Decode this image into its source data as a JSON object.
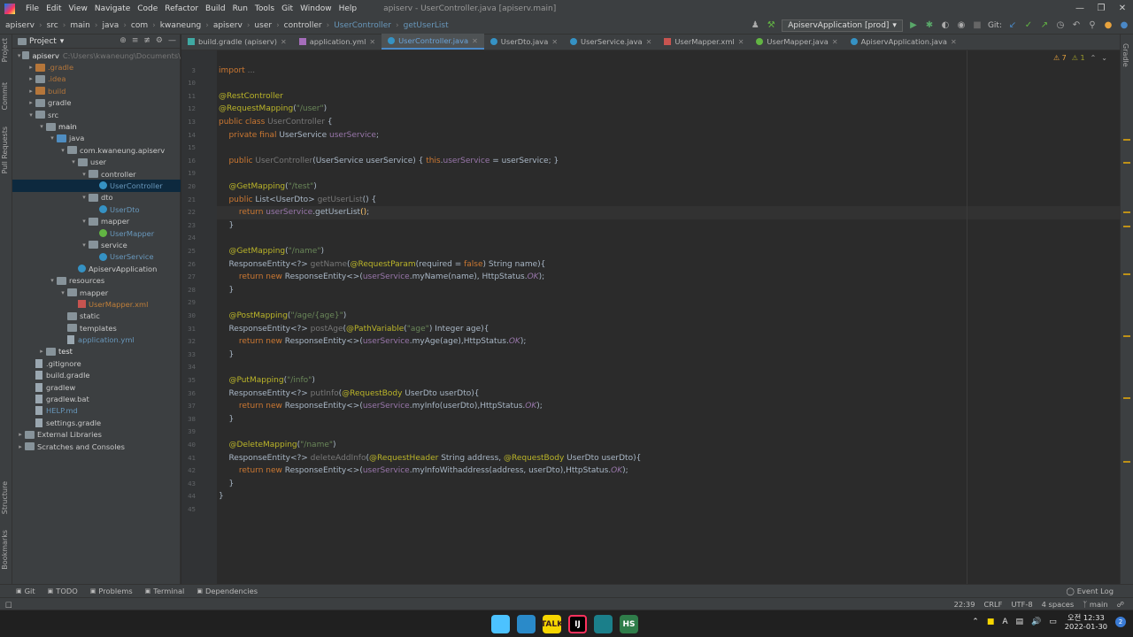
{
  "menubar": {
    "items": [
      "File",
      "Edit",
      "View",
      "Navigate",
      "Code",
      "Refactor",
      "Build",
      "Run",
      "Tools",
      "Git",
      "Window",
      "Help"
    ],
    "window_title": "apiserv - UserController.java [apiserv.main]",
    "controls": [
      "—",
      "❐",
      "✕"
    ]
  },
  "navbar": {
    "breadcrumbs": [
      "apiserv",
      "src",
      "main",
      "java",
      "com",
      "kwaneung",
      "apiserv",
      "user",
      "controller",
      "UserController",
      "getUserList"
    ],
    "run_config": "ApiservApplication [prod]",
    "git_label": "Git:"
  },
  "left_strip": [
    "Project",
    "Commit",
    "Pull Requests",
    "Structure",
    "Bookmarks"
  ],
  "project_panel": {
    "title": "Project",
    "tree": [
      {
        "label": "apiserv",
        "extra": "C:\\Users\\kwaneung\\Documents\\",
        "level": 0,
        "arrow": "▾",
        "icon": "folder",
        "style": "txt-bright"
      },
      {
        "label": ".gradle",
        "level": 1,
        "arrow": "▸",
        "icon": "folder orange",
        "style": "txt-orange"
      },
      {
        "label": ".idea",
        "level": 1,
        "arrow": "▸",
        "icon": "folder",
        "style": "txt-orange"
      },
      {
        "label": "build",
        "level": 1,
        "arrow": "▸",
        "icon": "folder orange",
        "style": "txt-orange"
      },
      {
        "label": "gradle",
        "level": 1,
        "arrow": "▸",
        "icon": "folder",
        "style": ""
      },
      {
        "label": "src",
        "level": 1,
        "arrow": "▾",
        "icon": "folder",
        "style": ""
      },
      {
        "label": "main",
        "level": 2,
        "arrow": "▾",
        "icon": "folder",
        "style": "txt-bright"
      },
      {
        "label": "java",
        "level": 3,
        "arrow": "▾",
        "icon": "folder blue",
        "style": ""
      },
      {
        "label": "com.kwaneung.apiserv",
        "level": 4,
        "arrow": "▾",
        "icon": "folder",
        "style": ""
      },
      {
        "label": "user",
        "level": 5,
        "arrow": "▾",
        "icon": "folder",
        "style": ""
      },
      {
        "label": "controller",
        "level": 6,
        "arrow": "▾",
        "icon": "folder",
        "style": ""
      },
      {
        "label": "UserController",
        "level": 7,
        "arrow": "",
        "icon": "cls",
        "style": "txt-blue",
        "selected": true
      },
      {
        "label": "dto",
        "level": 6,
        "arrow": "▾",
        "icon": "folder",
        "style": ""
      },
      {
        "label": "UserDto",
        "level": 7,
        "arrow": "",
        "icon": "cls",
        "style": "txt-blue"
      },
      {
        "label": "mapper",
        "level": 6,
        "arrow": "▾",
        "icon": "folder",
        "style": ""
      },
      {
        "label": "UserMapper",
        "level": 7,
        "arrow": "",
        "icon": "intf",
        "style": "txt-blue"
      },
      {
        "label": "service",
        "level": 6,
        "arrow": "▾",
        "icon": "folder",
        "style": ""
      },
      {
        "label": "UserService",
        "level": 7,
        "arrow": "",
        "icon": "cls",
        "style": "txt-blue"
      },
      {
        "label": "ApiservApplication",
        "level": 5,
        "arrow": "",
        "icon": "cls",
        "style": ""
      },
      {
        "label": "resources",
        "level": 3,
        "arrow": "▾",
        "icon": "folder",
        "style": ""
      },
      {
        "label": "mapper",
        "level": 4,
        "arrow": "▾",
        "icon": "folder",
        "style": ""
      },
      {
        "label": "UserMapper.xml",
        "level": 5,
        "arrow": "",
        "icon": "xml",
        "style": "txt-xml"
      },
      {
        "label": "static",
        "level": 4,
        "arrow": "",
        "icon": "folder",
        "style": ""
      },
      {
        "label": "templates",
        "level": 4,
        "arrow": "",
        "icon": "folder",
        "style": ""
      },
      {
        "label": "application.yml",
        "level": 4,
        "arrow": "",
        "icon": "file",
        "style": "txt-blue"
      },
      {
        "label": "test",
        "level": 2,
        "arrow": "▸",
        "icon": "folder",
        "style": "txt-bright"
      },
      {
        "label": ".gitignore",
        "level": 1,
        "arrow": "",
        "icon": "file",
        "style": ""
      },
      {
        "label": "build.gradle",
        "level": 1,
        "arrow": "",
        "icon": "file",
        "style": ""
      },
      {
        "label": "gradlew",
        "level": 1,
        "arrow": "",
        "icon": "file",
        "style": ""
      },
      {
        "label": "gradlew.bat",
        "level": 1,
        "arrow": "",
        "icon": "file",
        "style": ""
      },
      {
        "label": "HELP.md",
        "level": 1,
        "arrow": "",
        "icon": "file",
        "style": "txt-blue"
      },
      {
        "label": "settings.gradle",
        "level": 1,
        "arrow": "",
        "icon": "file",
        "style": ""
      },
      {
        "label": "External Libraries",
        "level": 0,
        "arrow": "▸",
        "icon": "folder",
        "style": ""
      },
      {
        "label": "Scratches and Consoles",
        "level": 0,
        "arrow": "▸",
        "icon": "folder",
        "style": ""
      }
    ]
  },
  "tabs": [
    {
      "label": "build.gradle (apiserv)",
      "icon": "gradle"
    },
    {
      "label": "application.yml",
      "icon": "yml"
    },
    {
      "label": "UserController.java",
      "icon": "cdot",
      "active": true
    },
    {
      "label": "UserDto.java",
      "icon": "cdot"
    },
    {
      "label": "UserService.java",
      "icon": "cdot"
    },
    {
      "label": "UserMapper.xml",
      "icon": "rdot"
    },
    {
      "label": "UserMapper.java",
      "icon": "gdot"
    },
    {
      "label": "ApiservApplication.java",
      "icon": "cdot"
    }
  ],
  "inspections": {
    "warnings": "⚠ 7",
    "weak": "⚠ 1"
  },
  "editor": {
    "current_line": 22,
    "lines": [
      {
        "n": "3",
        "t": [
          [
            "kw",
            "import "
          ],
          [
            "gr",
            "..."
          ]
        ]
      },
      {
        "n": "10",
        "t": []
      },
      {
        "n": "11",
        "t": [
          [
            "an",
            "@RestController"
          ]
        ]
      },
      {
        "n": "12",
        "t": [
          [
            "an",
            "@RequestMapping"
          ],
          [
            "pl",
            "("
          ],
          [
            "st",
            "\"/user\""
          ],
          [
            "pl",
            ")"
          ]
        ]
      },
      {
        "n": "13",
        "t": [
          [
            "kw",
            "public class "
          ],
          [
            "gr",
            "UserController"
          ],
          [
            "pl",
            " {"
          ]
        ]
      },
      {
        "n": "14",
        "t": [
          [
            "pl",
            "    "
          ],
          [
            "kw",
            "private final "
          ],
          [
            "pl",
            "UserService "
          ],
          [
            "fd",
            "userService"
          ],
          [
            "pl",
            ";"
          ]
        ]
      },
      {
        "n": "15",
        "t": []
      },
      {
        "n": "16",
        "t": [
          [
            "pl",
            "    "
          ],
          [
            "kw",
            "public "
          ],
          [
            "gr",
            "UserController"
          ],
          [
            "pl",
            "(UserService userService) { "
          ],
          [
            "kw",
            "this"
          ],
          [
            "pl",
            "."
          ],
          [
            "fd",
            "userService"
          ],
          [
            "pl",
            " = userService; }"
          ]
        ]
      },
      {
        "n": "19",
        "t": []
      },
      {
        "n": "20",
        "t": [
          [
            "pl",
            "    "
          ],
          [
            "an",
            "@GetMapping"
          ],
          [
            "pl",
            "("
          ],
          [
            "st",
            "\"/test\""
          ],
          [
            "pl",
            ")"
          ]
        ]
      },
      {
        "n": "21",
        "t": [
          [
            "pl",
            "    "
          ],
          [
            "kw",
            "public "
          ],
          [
            "pl",
            "List<UserDto> "
          ],
          [
            "gr",
            "getUserList"
          ],
          [
            "pl",
            "() {"
          ]
        ]
      },
      {
        "n": "22",
        "t": [
          [
            "pl",
            "        "
          ],
          [
            "kw",
            "return "
          ],
          [
            "fd",
            "userService"
          ],
          [
            "pl",
            ".getUserList"
          ],
          [
            "fn",
            "()"
          ],
          [
            "pl",
            ";"
          ]
        ]
      },
      {
        "n": "23",
        "t": [
          [
            "pl",
            "    }"
          ]
        ]
      },
      {
        "n": "24",
        "t": []
      },
      {
        "n": "25",
        "t": [
          [
            "pl",
            "    "
          ],
          [
            "an",
            "@GetMapping"
          ],
          [
            "pl",
            "("
          ],
          [
            "st",
            "\"/name\""
          ],
          [
            "pl",
            ")"
          ]
        ]
      },
      {
        "n": "26",
        "t": [
          [
            "pl",
            "    ResponseEntity<?> "
          ],
          [
            "gr",
            "getName"
          ],
          [
            "pl",
            "("
          ],
          [
            "an",
            "@RequestParam"
          ],
          [
            "pl",
            "(required = "
          ],
          [
            "kw",
            "false"
          ],
          [
            "pl",
            ") String name){"
          ]
        ]
      },
      {
        "n": "27",
        "t": [
          [
            "pl",
            "        "
          ],
          [
            "kw",
            "return new "
          ],
          [
            "pl",
            "ResponseEntity<>("
          ],
          [
            "fd",
            "userService"
          ],
          [
            "pl",
            ".myName(name), HttpStatus."
          ],
          [
            "it",
            "OK"
          ],
          [
            "pl",
            ");"
          ]
        ]
      },
      {
        "n": "28",
        "t": [
          [
            "pl",
            "    }"
          ]
        ]
      },
      {
        "n": "29",
        "t": []
      },
      {
        "n": "30",
        "t": [
          [
            "pl",
            "    "
          ],
          [
            "an",
            "@PostMapping"
          ],
          [
            "pl",
            "("
          ],
          [
            "st",
            "\"/age/{age}\""
          ],
          [
            "pl",
            ")"
          ]
        ]
      },
      {
        "n": "31",
        "t": [
          [
            "pl",
            "    ResponseEntity<?> "
          ],
          [
            "gr",
            "postAge"
          ],
          [
            "pl",
            "("
          ],
          [
            "an",
            "@PathVariable"
          ],
          [
            "pl",
            "("
          ],
          [
            "st",
            "\"age\""
          ],
          [
            "pl",
            ") Integer age){"
          ]
        ]
      },
      {
        "n": "32",
        "t": [
          [
            "pl",
            "        "
          ],
          [
            "kw",
            "return new "
          ],
          [
            "pl",
            "ResponseEntity<>("
          ],
          [
            "fd",
            "userService"
          ],
          [
            "pl",
            ".myAge(age),HttpStatus."
          ],
          [
            "it",
            "OK"
          ],
          [
            "pl",
            ");"
          ]
        ]
      },
      {
        "n": "33",
        "t": [
          [
            "pl",
            "    }"
          ]
        ]
      },
      {
        "n": "34",
        "t": []
      },
      {
        "n": "35",
        "t": [
          [
            "pl",
            "    "
          ],
          [
            "an",
            "@PutMapping"
          ],
          [
            "pl",
            "("
          ],
          [
            "st",
            "\"/info\""
          ],
          [
            "pl",
            ")"
          ]
        ]
      },
      {
        "n": "36",
        "t": [
          [
            "pl",
            "    ResponseEntity<?> "
          ],
          [
            "gr",
            "putInfo"
          ],
          [
            "pl",
            "("
          ],
          [
            "an",
            "@RequestBody"
          ],
          [
            "pl",
            " UserDto userDto){"
          ]
        ]
      },
      {
        "n": "37",
        "t": [
          [
            "pl",
            "        "
          ],
          [
            "kw",
            "return new "
          ],
          [
            "pl",
            "ResponseEntity<>("
          ],
          [
            "fd",
            "userService"
          ],
          [
            "pl",
            ".myInfo(userDto),HttpStatus."
          ],
          [
            "it",
            "OK"
          ],
          [
            "pl",
            ");"
          ]
        ]
      },
      {
        "n": "38",
        "t": [
          [
            "pl",
            "    }"
          ]
        ]
      },
      {
        "n": "39",
        "t": []
      },
      {
        "n": "40",
        "t": [
          [
            "pl",
            "    "
          ],
          [
            "an",
            "@DeleteMapping"
          ],
          [
            "pl",
            "("
          ],
          [
            "st",
            "\"/name\""
          ],
          [
            "pl",
            ")"
          ]
        ]
      },
      {
        "n": "41",
        "t": [
          [
            "pl",
            "    ResponseEntity<?> "
          ],
          [
            "gr",
            "deleteAddInfo"
          ],
          [
            "pl",
            "("
          ],
          [
            "an",
            "@RequestHeader"
          ],
          [
            "pl",
            " String address, "
          ],
          [
            "an",
            "@RequestBody"
          ],
          [
            "pl",
            " UserDto userDto){"
          ]
        ]
      },
      {
        "n": "42",
        "t": [
          [
            "pl",
            "        "
          ],
          [
            "kw",
            "return new "
          ],
          [
            "pl",
            "ResponseEntity<>("
          ],
          [
            "fd",
            "userService"
          ],
          [
            "pl",
            ".myInfoWithaddress(address, userDto),HttpStatus."
          ],
          [
            "it",
            "OK"
          ],
          [
            "pl",
            ");"
          ]
        ]
      },
      {
        "n": "43",
        "t": [
          [
            "pl",
            "    }"
          ]
        ]
      },
      {
        "n": "44",
        "t": [
          [
            "pl",
            "}"
          ]
        ]
      },
      {
        "n": "45",
        "t": []
      }
    ]
  },
  "right_strip": [
    "Gradle"
  ],
  "bottom_tools": [
    {
      "label": "Git",
      "icon": "branch-icon"
    },
    {
      "label": "TODO",
      "icon": "list-icon"
    },
    {
      "label": "Problems",
      "icon": "info-icon"
    },
    {
      "label": "Terminal",
      "icon": "terminal-icon"
    },
    {
      "label": "Dependencies",
      "icon": "deps-icon"
    }
  ],
  "event_log": "Event Log",
  "status": {
    "position": "22:39",
    "line_sep": "CRLF",
    "encoding": "UTF-8",
    "indent": "4 spaces",
    "branch": "main"
  },
  "taskbar": {
    "apps": [
      {
        "name": "windows-start",
        "label": "",
        "color": "#4cc2ff"
      },
      {
        "name": "bird-app",
        "label": "",
        "color": "#2a8ac9"
      },
      {
        "name": "kakaotalk",
        "label": "TALK",
        "color": "#f7d600"
      },
      {
        "name": "intellij",
        "label": "IJ",
        "color": "#000000"
      },
      {
        "name": "network-app",
        "label": "",
        "color": "#1b7f8a"
      },
      {
        "name": "hs-app",
        "label": "HS",
        "color": "#2f7d4a"
      }
    ],
    "ime": "A",
    "time": "오전 12:33",
    "date": "2022-01-30",
    "notification_count": "2"
  }
}
